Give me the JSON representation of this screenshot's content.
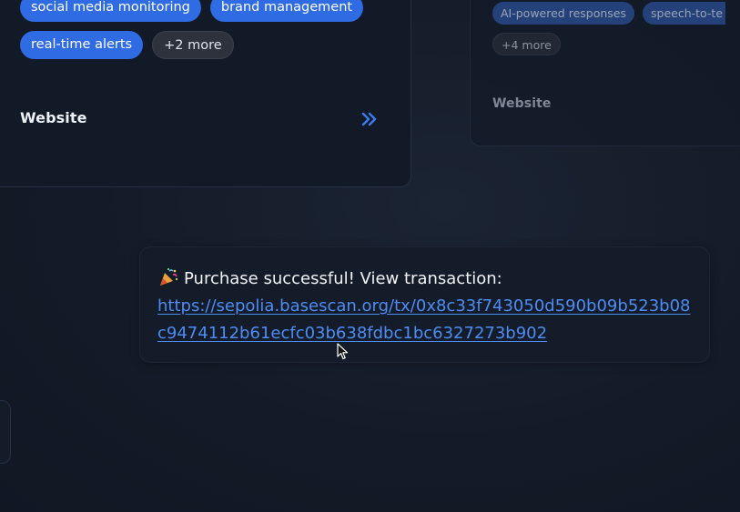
{
  "cards": {
    "left": {
      "tags": [
        "social media monitoring",
        "brand management",
        "real-time alerts"
      ],
      "more_label": "+2 more",
      "website_label": "Website"
    },
    "right": {
      "tags": [
        "AI-powered responses",
        "speech-to-te"
      ],
      "more_label": "+4 more",
      "website_label": "Website"
    }
  },
  "toast": {
    "message": "Purchase successful! View transaction:",
    "link": "https://sepolia.basescan.org/tx/0x8c33f743050d590b09b523b08c9474112b61ecfc03b638fdbc1bc6327273b902"
  },
  "colors": {
    "background": "#141b28",
    "card": "#121a28",
    "tag_blue": "#2f6be2",
    "link": "#4d8cf5",
    "chevron": "#3d7cf0"
  },
  "icons": {
    "chevron": "chevron-double-right-icon",
    "party": "party-popper-icon",
    "cursor": "mouse-pointer-icon"
  }
}
